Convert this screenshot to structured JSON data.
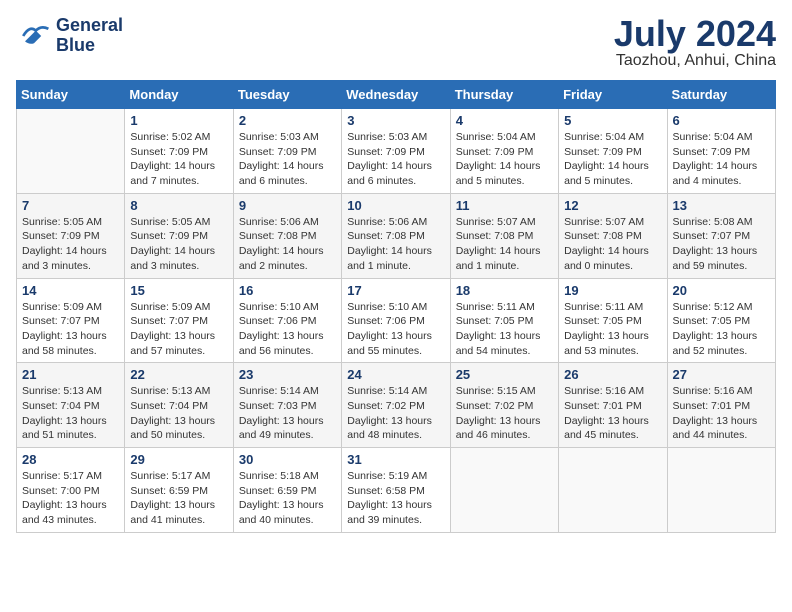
{
  "header": {
    "logo_line1": "General",
    "logo_line2": "Blue",
    "month": "July 2024",
    "location": "Taozhou, Anhui, China"
  },
  "weekdays": [
    "Sunday",
    "Monday",
    "Tuesday",
    "Wednesday",
    "Thursday",
    "Friday",
    "Saturday"
  ],
  "weeks": [
    [
      {
        "day": "",
        "info": ""
      },
      {
        "day": "1",
        "info": "Sunrise: 5:02 AM\nSunset: 7:09 PM\nDaylight: 14 hours\nand 7 minutes."
      },
      {
        "day": "2",
        "info": "Sunrise: 5:03 AM\nSunset: 7:09 PM\nDaylight: 14 hours\nand 6 minutes."
      },
      {
        "day": "3",
        "info": "Sunrise: 5:03 AM\nSunset: 7:09 PM\nDaylight: 14 hours\nand 6 minutes."
      },
      {
        "day": "4",
        "info": "Sunrise: 5:04 AM\nSunset: 7:09 PM\nDaylight: 14 hours\nand 5 minutes."
      },
      {
        "day": "5",
        "info": "Sunrise: 5:04 AM\nSunset: 7:09 PM\nDaylight: 14 hours\nand 5 minutes."
      },
      {
        "day": "6",
        "info": "Sunrise: 5:04 AM\nSunset: 7:09 PM\nDaylight: 14 hours\nand 4 minutes."
      }
    ],
    [
      {
        "day": "7",
        "info": "Sunrise: 5:05 AM\nSunset: 7:09 PM\nDaylight: 14 hours\nand 3 minutes."
      },
      {
        "day": "8",
        "info": "Sunrise: 5:05 AM\nSunset: 7:09 PM\nDaylight: 14 hours\nand 3 minutes."
      },
      {
        "day": "9",
        "info": "Sunrise: 5:06 AM\nSunset: 7:08 PM\nDaylight: 14 hours\nand 2 minutes."
      },
      {
        "day": "10",
        "info": "Sunrise: 5:06 AM\nSunset: 7:08 PM\nDaylight: 14 hours\nand 1 minute."
      },
      {
        "day": "11",
        "info": "Sunrise: 5:07 AM\nSunset: 7:08 PM\nDaylight: 14 hours\nand 1 minute."
      },
      {
        "day": "12",
        "info": "Sunrise: 5:07 AM\nSunset: 7:08 PM\nDaylight: 14 hours\nand 0 minutes."
      },
      {
        "day": "13",
        "info": "Sunrise: 5:08 AM\nSunset: 7:07 PM\nDaylight: 13 hours\nand 59 minutes."
      }
    ],
    [
      {
        "day": "14",
        "info": "Sunrise: 5:09 AM\nSunset: 7:07 PM\nDaylight: 13 hours\nand 58 minutes."
      },
      {
        "day": "15",
        "info": "Sunrise: 5:09 AM\nSunset: 7:07 PM\nDaylight: 13 hours\nand 57 minutes."
      },
      {
        "day": "16",
        "info": "Sunrise: 5:10 AM\nSunset: 7:06 PM\nDaylight: 13 hours\nand 56 minutes."
      },
      {
        "day": "17",
        "info": "Sunrise: 5:10 AM\nSunset: 7:06 PM\nDaylight: 13 hours\nand 55 minutes."
      },
      {
        "day": "18",
        "info": "Sunrise: 5:11 AM\nSunset: 7:05 PM\nDaylight: 13 hours\nand 54 minutes."
      },
      {
        "day": "19",
        "info": "Sunrise: 5:11 AM\nSunset: 7:05 PM\nDaylight: 13 hours\nand 53 minutes."
      },
      {
        "day": "20",
        "info": "Sunrise: 5:12 AM\nSunset: 7:05 PM\nDaylight: 13 hours\nand 52 minutes."
      }
    ],
    [
      {
        "day": "21",
        "info": "Sunrise: 5:13 AM\nSunset: 7:04 PM\nDaylight: 13 hours\nand 51 minutes."
      },
      {
        "day": "22",
        "info": "Sunrise: 5:13 AM\nSunset: 7:04 PM\nDaylight: 13 hours\nand 50 minutes."
      },
      {
        "day": "23",
        "info": "Sunrise: 5:14 AM\nSunset: 7:03 PM\nDaylight: 13 hours\nand 49 minutes."
      },
      {
        "day": "24",
        "info": "Sunrise: 5:14 AM\nSunset: 7:02 PM\nDaylight: 13 hours\nand 48 minutes."
      },
      {
        "day": "25",
        "info": "Sunrise: 5:15 AM\nSunset: 7:02 PM\nDaylight: 13 hours\nand 46 minutes."
      },
      {
        "day": "26",
        "info": "Sunrise: 5:16 AM\nSunset: 7:01 PM\nDaylight: 13 hours\nand 45 minutes."
      },
      {
        "day": "27",
        "info": "Sunrise: 5:16 AM\nSunset: 7:01 PM\nDaylight: 13 hours\nand 44 minutes."
      }
    ],
    [
      {
        "day": "28",
        "info": "Sunrise: 5:17 AM\nSunset: 7:00 PM\nDaylight: 13 hours\nand 43 minutes."
      },
      {
        "day": "29",
        "info": "Sunrise: 5:17 AM\nSunset: 6:59 PM\nDaylight: 13 hours\nand 41 minutes."
      },
      {
        "day": "30",
        "info": "Sunrise: 5:18 AM\nSunset: 6:59 PM\nDaylight: 13 hours\nand 40 minutes."
      },
      {
        "day": "31",
        "info": "Sunrise: 5:19 AM\nSunset: 6:58 PM\nDaylight: 13 hours\nand 39 minutes."
      },
      {
        "day": "",
        "info": ""
      },
      {
        "day": "",
        "info": ""
      },
      {
        "day": "",
        "info": ""
      }
    ]
  ]
}
